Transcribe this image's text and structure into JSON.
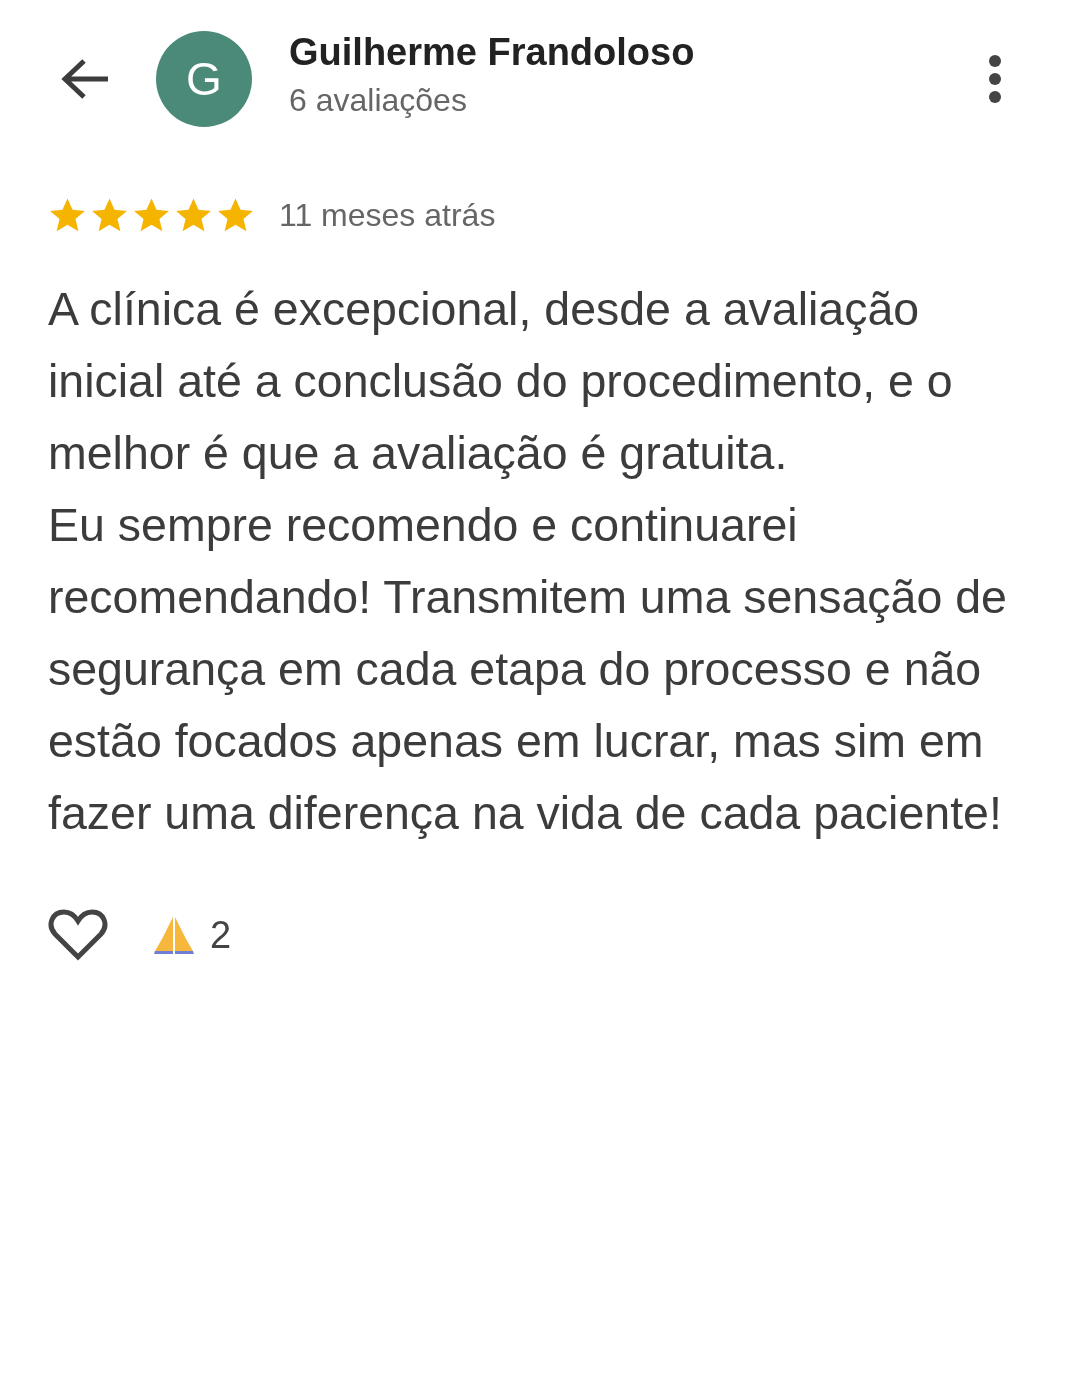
{
  "header": {
    "avatar_letter": "G",
    "name": "Guilherme Frandoloso",
    "subtitle": "6 avaliações"
  },
  "review": {
    "stars": 5,
    "time": "11 meses atrás",
    "text": "A clínica é excepcional, desde a avaliação inicial até a conclusão do procedimento, e o melhor é que a avaliação é gratuita.\nEu sempre recomendo e continuarei recomendando! Transmitem uma sensação de segurança em cada etapa do processo e não estão focados apenas em lucrar, mas sim em fazer uma diferença na vida de cada paciente!"
  },
  "reactions": {
    "liked": false,
    "count": "2"
  }
}
